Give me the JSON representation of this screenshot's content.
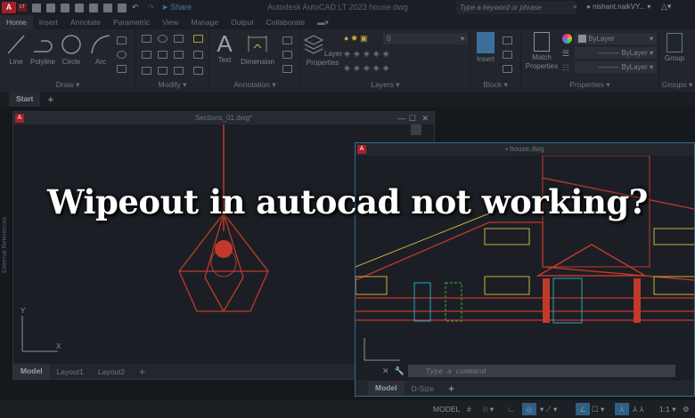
{
  "titlebar": {
    "logo": "A",
    "edition": "LT",
    "share": "Share",
    "title": "Autodesk AutoCAD LT 2023   house.dwg",
    "search_placeholder": "Type a keyword or phrase",
    "user": "nishant.naikVY..."
  },
  "tabs": [
    "Home",
    "Insert",
    "Annotate",
    "Parametric",
    "View",
    "Manage",
    "Output",
    "Collaborate"
  ],
  "ribbon": {
    "draw": {
      "label": "Draw",
      "tools": [
        "Line",
        "Polyline",
        "Circle",
        "Arc"
      ]
    },
    "modify": {
      "label": "Modify"
    },
    "annotation": {
      "label": "Annotation",
      "tools": [
        "Text",
        "Dimension"
      ]
    },
    "layers": {
      "label": "Layers",
      "tool": "Layer Properties",
      "layer_value": "0"
    },
    "block": {
      "label": "Block",
      "tool": "Insert"
    },
    "properties": {
      "label": "Properties",
      "tool": "Match Properties",
      "color": "ByLayer",
      "linetype": "ByLayer",
      "lineweight": "ByLayer"
    },
    "groups": {
      "label": "Groups",
      "tool": "Group"
    }
  },
  "filetabs": {
    "start": "Start",
    "add": "+"
  },
  "left_window": {
    "title": "Sections_01.dwg*",
    "side_label": "External References",
    "layout_tabs": [
      "Model",
      "Layout1",
      "Layout2"
    ],
    "add": "+"
  },
  "right_window": {
    "title": "house.dwg",
    "command_placeholder": "Type a command",
    "layout_tabs": [
      "Model",
      "D-Size"
    ],
    "add": "+"
  },
  "status": {
    "model": "MODEL",
    "scale": "1:1"
  },
  "overlay": {
    "headline": "Wipeout in autocad not working?"
  },
  "colors": {
    "accent": "#a3202b",
    "drawing_red": "#c0392b",
    "drawing_yellow": "#c9b23a",
    "drawing_cyan": "#2aa7b8",
    "drawing_green": "#3fae3f"
  }
}
